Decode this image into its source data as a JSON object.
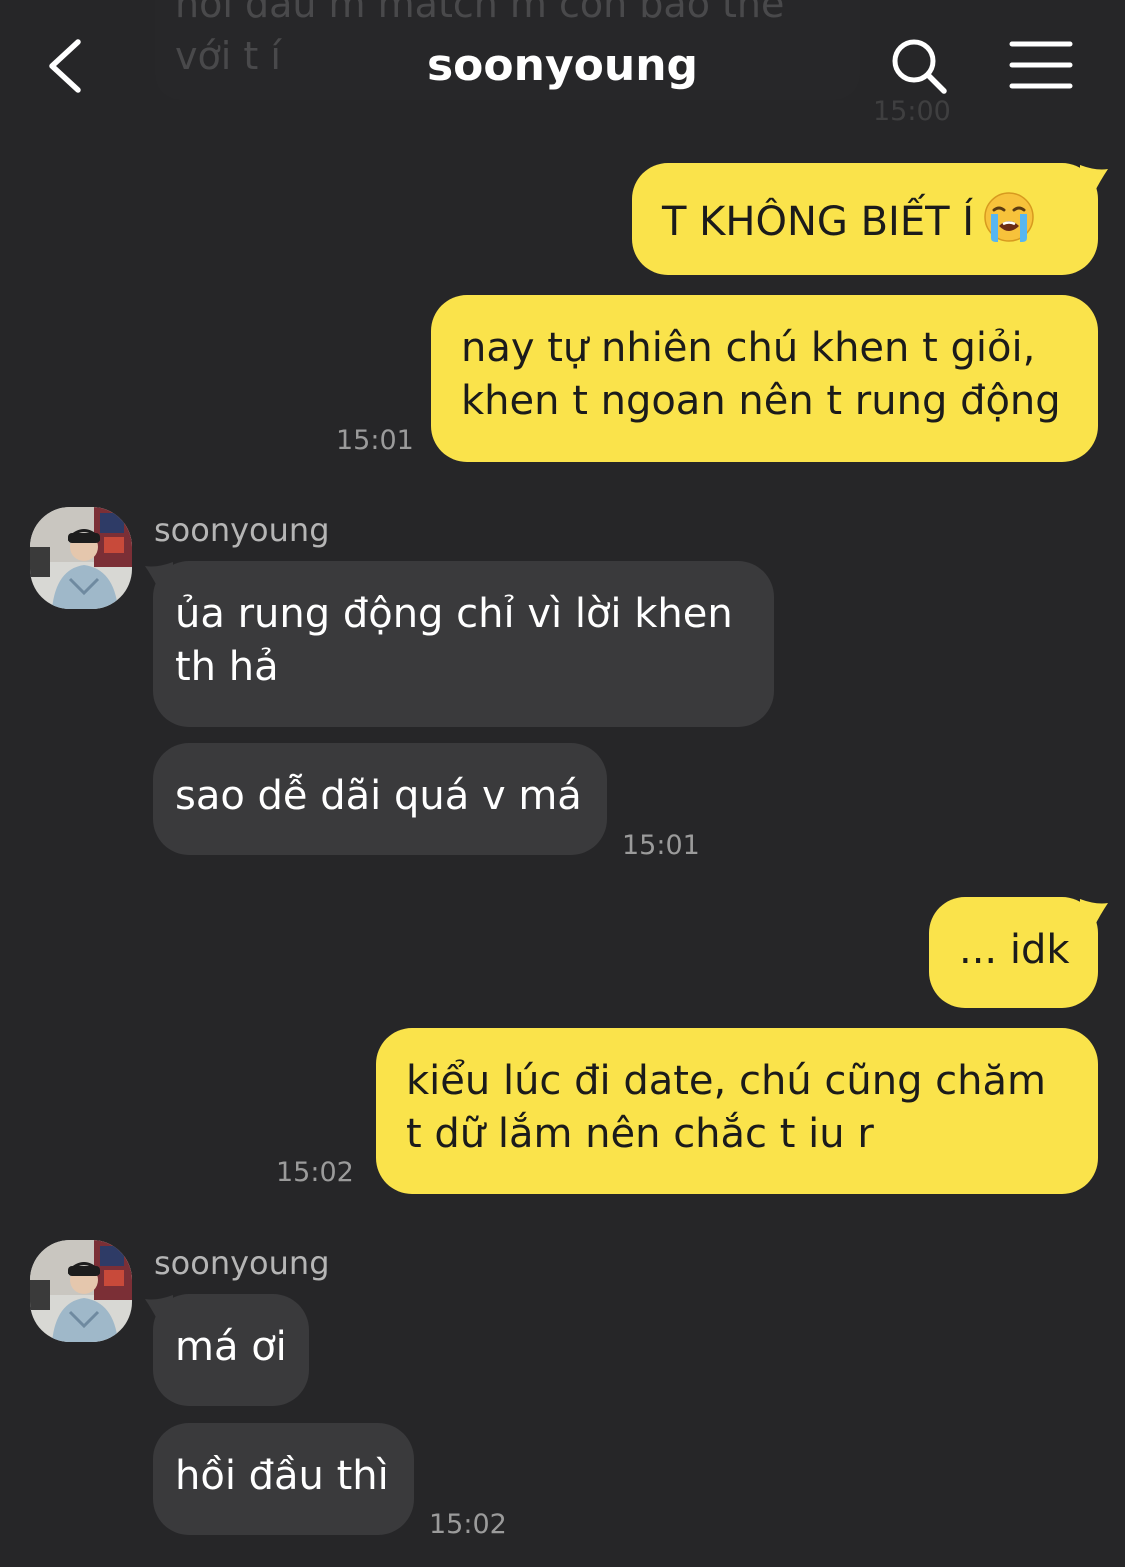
{
  "header": {
    "title": "soonyoung",
    "back_icon": "chevron-left-icon",
    "search_icon": "search-icon",
    "menu_icon": "hamburger-menu-icon"
  },
  "colors": {
    "background": "#262628",
    "outgoing_bubble": "#fae34b",
    "incoming_bubble": "#3a3a3c"
  },
  "ghost_message": {
    "text": "hồi đầu m match m còn bảo thế\nvới t í",
    "time": "15:00"
  },
  "messages": {
    "m1": {
      "text": "T KHÔNG BIẾT Í",
      "emoji": "loudly-crying-face-icon"
    },
    "m2": {
      "text": "nay tự nhiên chú khen t giỏi,\nkhen t ngoan nên t rung động",
      "time": "15:01"
    },
    "g1": {
      "sender": "soonyoung"
    },
    "m3": {
      "text": "ủa rung động chỉ vì lời khen\nth hả"
    },
    "m4": {
      "text": "sao dễ dãi quá v má",
      "time": "15:01"
    },
    "m5": {
      "text": "... idk"
    },
    "m6": {
      "text": "kiểu lúc đi date, chú cũng chăm\nt dữ lắm nên chắc t iu r",
      "time": "15:02"
    },
    "g2": {
      "sender": "soonyoung"
    },
    "m7": {
      "text": "má ơi"
    },
    "m8": {
      "text": "hồi đầu thì",
      "time": "15:02"
    }
  }
}
